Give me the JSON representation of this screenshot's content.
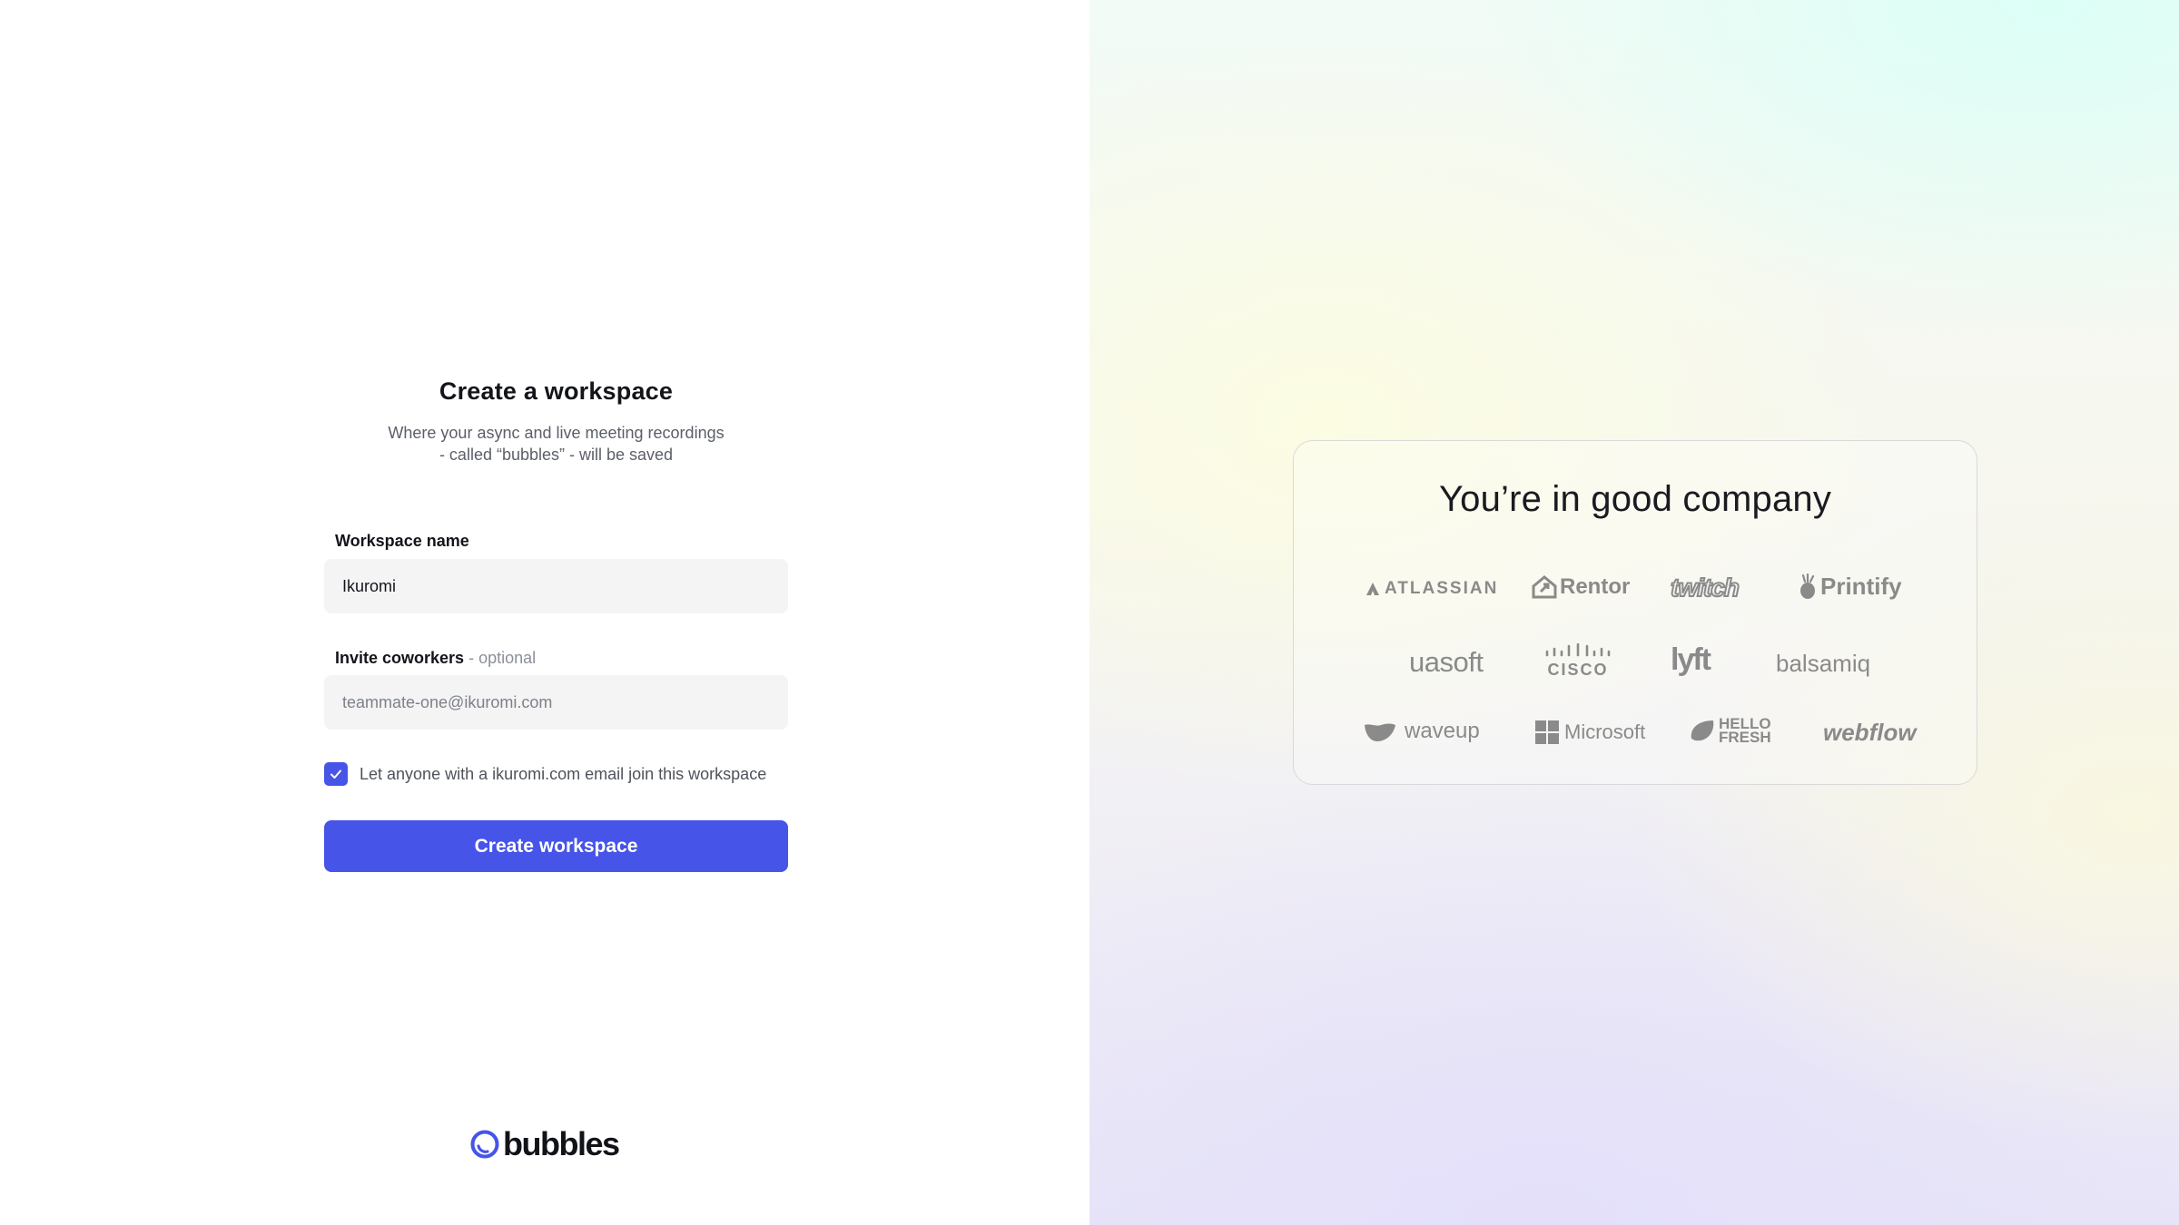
{
  "form": {
    "title": "Create a workspace",
    "subtitle": "Where your async and live meeting recordings - called “bubbles” - will be saved",
    "workspace_label": "Workspace name",
    "workspace_value": "Ikuromi",
    "invite_label": "Invite coworkers",
    "invite_optional": "- optional",
    "invite_placeholder": "teammate-one@ikuromi.com",
    "checkbox_checked": true,
    "checkbox_label": "Let anyone with a ikuromi.com email join this workspace",
    "submit_label": "Create workspace"
  },
  "brand": {
    "name": "bubbles",
    "accent": "#4654e8"
  },
  "companies": {
    "title": "You’re in good company",
    "logos": [
      {
        "name": "ATLASSIAN",
        "icon": "atlassian-icon"
      },
      {
        "name": "Rentor",
        "icon": "rentor-icon"
      },
      {
        "name": "twitch",
        "icon": "twitch-icon"
      },
      {
        "name": "Printify",
        "icon": "printify-icon"
      },
      {
        "name": "uasoft",
        "icon": "uasoft-icon"
      },
      {
        "name": "CISCO",
        "icon": "cisco-icon"
      },
      {
        "name": "lyft",
        "icon": "lyft-icon"
      },
      {
        "name": "balsamiq",
        "icon": "balsamiq-icon"
      },
      {
        "name": "waveup",
        "icon": "waveup-icon"
      },
      {
        "name": "Microsoft",
        "icon": "microsoft-icon"
      },
      {
        "name": "HELLO FRESH",
        "icon": "hellofresh-icon"
      },
      {
        "name": "webflow",
        "icon": "webflow-icon"
      }
    ]
  }
}
